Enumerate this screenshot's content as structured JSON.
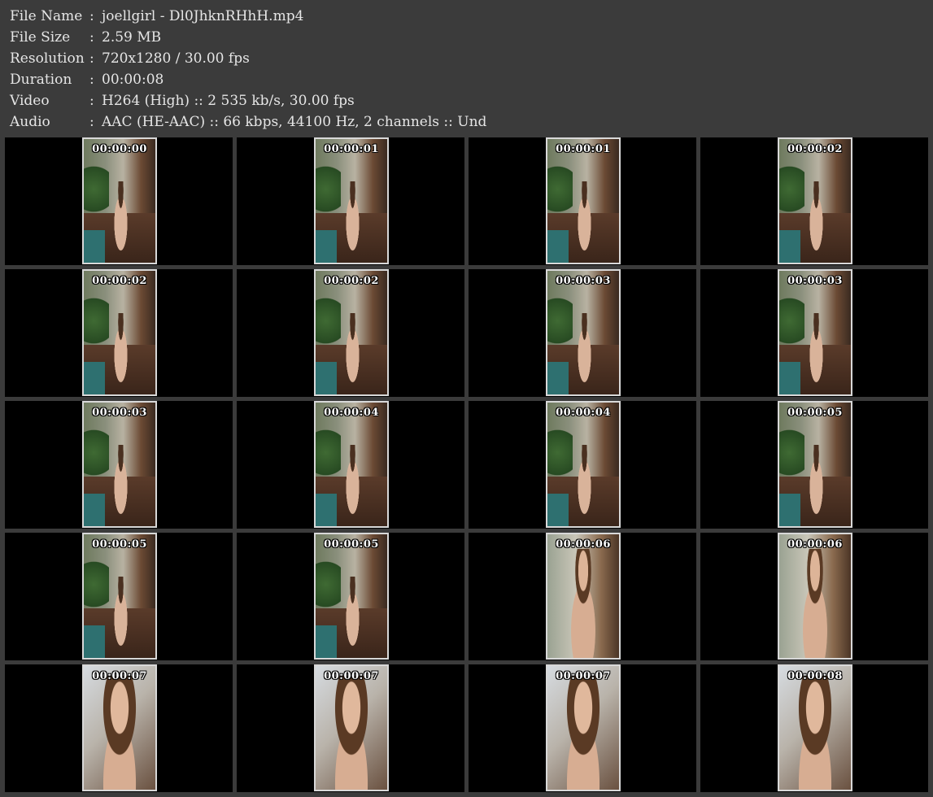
{
  "info": [
    {
      "label": "File Name",
      "sep": ":",
      "value": "joellgirl - Dl0JhknRHhH.mp4"
    },
    {
      "label": "File Size",
      "sep": ":",
      "value": "2.59 MB"
    },
    {
      "label": "Resolution",
      "sep": ":",
      "value": "720x1280 / 30.00 fps"
    },
    {
      "label": "Duration",
      "sep": ":",
      "value": "00:00:08"
    },
    {
      "label": "Video",
      "sep": ":",
      "value": "H264 (High) :: 2 535 kb/s, 30.00 fps"
    },
    {
      "label": "Audio",
      "sep": ":",
      "value": "AAC (HE-AAC) :: 66 kbps, 44100 Hz, 2 channels :: Und"
    }
  ],
  "thumbnails": [
    {
      "timestamp": "00:00:00",
      "scene": "pool-wide"
    },
    {
      "timestamp": "00:00:01",
      "scene": "pool-wide"
    },
    {
      "timestamp": "00:00:01",
      "scene": "pool-wide"
    },
    {
      "timestamp": "00:00:02",
      "scene": "pool-wide"
    },
    {
      "timestamp": "00:00:02",
      "scene": "pool-wide"
    },
    {
      "timestamp": "00:00:02",
      "scene": "pool-wide"
    },
    {
      "timestamp": "00:00:03",
      "scene": "pool-wide"
    },
    {
      "timestamp": "00:00:03",
      "scene": "pool-wide"
    },
    {
      "timestamp": "00:00:03",
      "scene": "pool-wide"
    },
    {
      "timestamp": "00:00:04",
      "scene": "pool-wide"
    },
    {
      "timestamp": "00:00:04",
      "scene": "pool-wide"
    },
    {
      "timestamp": "00:00:05",
      "scene": "pool-wide"
    },
    {
      "timestamp": "00:00:05",
      "scene": "pool-wide"
    },
    {
      "timestamp": "00:00:05",
      "scene": "pool-wide"
    },
    {
      "timestamp": "00:00:06",
      "scene": "medium"
    },
    {
      "timestamp": "00:00:06",
      "scene": "medium"
    },
    {
      "timestamp": "00:00:07",
      "scene": "close"
    },
    {
      "timestamp": "00:00:07",
      "scene": "close"
    },
    {
      "timestamp": "00:00:07",
      "scene": "close"
    },
    {
      "timestamp": "00:00:08",
      "scene": "close-bright"
    }
  ]
}
